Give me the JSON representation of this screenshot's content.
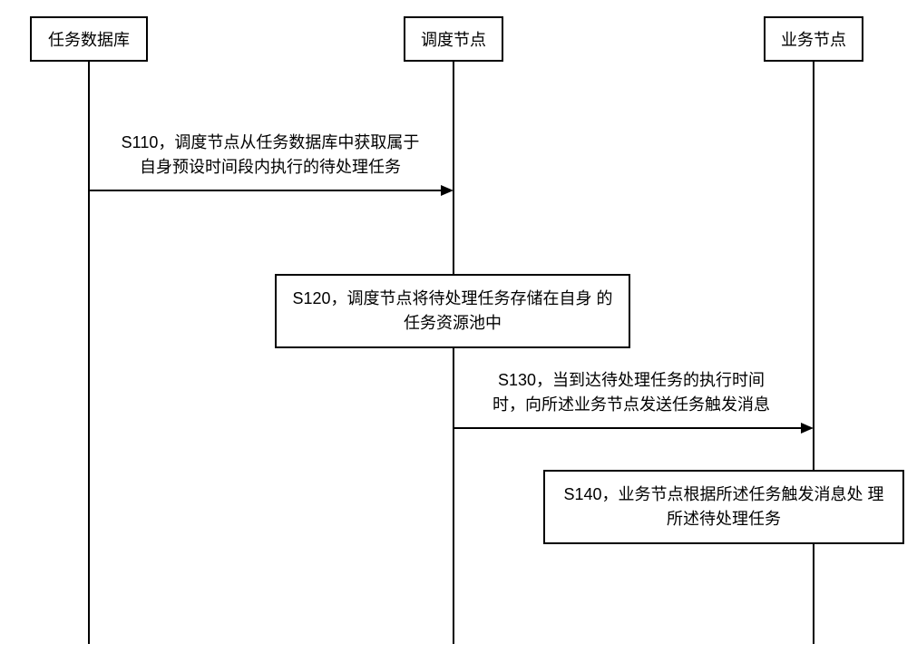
{
  "participants": {
    "db": "任务数据库",
    "scheduler": "调度节点",
    "business": "业务节点"
  },
  "steps": {
    "s110": "S110，调度节点从任务数据库中获取属于\n自身预设时间段内执行的待处理任务",
    "s120": "S120，调度节点将待处理任务存储在自身\n的任务资源池中",
    "s130": "S130，当到达待处理任务的执行时间\n时，向所述业务节点发送任务触发消息",
    "s140": "S140，业务节点根据所述任务触发消息处\n理所述待处理任务"
  },
  "chart_data": {
    "type": "sequence-diagram",
    "participants": [
      "任务数据库",
      "调度节点",
      "业务节点"
    ],
    "messages": [
      {
        "id": "S110",
        "from": "任务数据库",
        "to": "调度节点",
        "text": "调度节点从任务数据库中获取属于自身预设时间段内执行的待处理任务"
      },
      {
        "id": "S120",
        "at": "调度节点",
        "text": "调度节点将待处理任务存储在自身的任务资源池中",
        "kind": "self-note"
      },
      {
        "id": "S130",
        "from": "调度节点",
        "to": "业务节点",
        "text": "当到达待处理任务的执行时间时，向所述业务节点发送任务触发消息"
      },
      {
        "id": "S140",
        "at": "业务节点",
        "text": "业务节点根据所述任务触发消息处理所述待处理任务",
        "kind": "self-note"
      }
    ]
  }
}
